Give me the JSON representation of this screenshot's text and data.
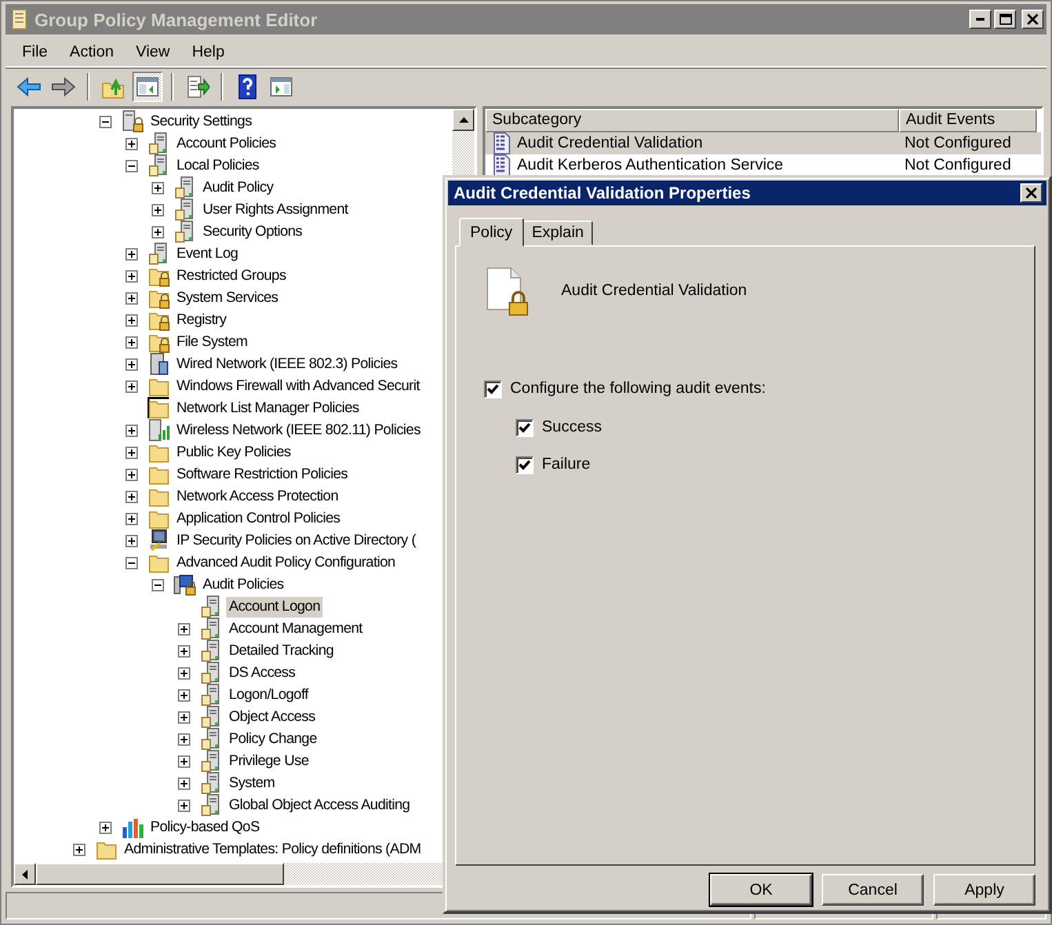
{
  "window": {
    "title": "Group Policy Management Editor"
  },
  "menu": [
    "File",
    "Action",
    "View",
    "Help"
  ],
  "toolbar": [
    {
      "kind": "back",
      "pressed": false
    },
    {
      "kind": "forward",
      "pressed": false
    },
    {
      "kind": "separator"
    },
    {
      "kind": "up",
      "pressed": false
    },
    {
      "kind": "tree-toggle",
      "pressed": true
    },
    {
      "kind": "separator"
    },
    {
      "kind": "export",
      "pressed": false
    },
    {
      "kind": "separator"
    },
    {
      "kind": "help",
      "pressed": false
    },
    {
      "kind": "action-pane",
      "pressed": false
    }
  ],
  "tree": {
    "items": [
      {
        "label": "Security Settings",
        "kind": "security",
        "expandable": true,
        "expanded": true,
        "selected": false,
        "children": [
          {
            "label": "Account Policies",
            "kind": "server",
            "expandable": true,
            "expanded": false,
            "selected": false
          },
          {
            "label": "Local Policies",
            "kind": "server",
            "expandable": true,
            "expanded": true,
            "selected": false,
            "children": [
              {
                "label": "Audit Policy",
                "kind": "server",
                "expandable": true,
                "expanded": false,
                "selected": false
              },
              {
                "label": "User Rights Assignment",
                "kind": "server",
                "expandable": true,
                "expanded": false,
                "selected": false
              },
              {
                "label": "Security Options",
                "kind": "server",
                "expandable": true,
                "expanded": false,
                "selected": false
              }
            ]
          },
          {
            "label": "Event Log",
            "kind": "server",
            "expandable": true,
            "expanded": false,
            "selected": false
          },
          {
            "label": "Restricted Groups",
            "kind": "folder-lock",
            "expandable": true,
            "expanded": false,
            "selected": false
          },
          {
            "label": "System Services",
            "kind": "folder-lock",
            "expandable": true,
            "expanded": false,
            "selected": false
          },
          {
            "label": "Registry",
            "kind": "folder-lock",
            "expandable": true,
            "expanded": false,
            "selected": false
          },
          {
            "label": "File System",
            "kind": "folder-lock",
            "expandable": true,
            "expanded": false,
            "selected": false
          },
          {
            "label": "Wired Network (IEEE 802.3) Policies",
            "kind": "wired",
            "expandable": true,
            "expanded": false,
            "selected": false
          },
          {
            "label": "Windows Firewall with Advanced Securit",
            "kind": "folder",
            "expandable": true,
            "expanded": false,
            "selected": false
          },
          {
            "label": "Network List Manager Policies",
            "kind": "folder-framed",
            "expandable": false,
            "selected": false
          },
          {
            "label": "Wireless Network (IEEE 802.11) Policies",
            "kind": "wireless",
            "expandable": true,
            "expanded": false,
            "selected": false
          },
          {
            "label": "Public Key Policies",
            "kind": "folder",
            "expandable": true,
            "expanded": false,
            "selected": false
          },
          {
            "label": "Software Restriction Policies",
            "kind": "folder",
            "expandable": true,
            "expanded": false,
            "selected": false
          },
          {
            "label": "Network Access Protection",
            "kind": "folder",
            "expandable": true,
            "expanded": false,
            "selected": false
          },
          {
            "label": "Application Control Policies",
            "kind": "folder",
            "expandable": true,
            "expanded": false,
            "selected": false
          },
          {
            "label": "IP Security Policies on Active Directory (",
            "kind": "ipsec",
            "expandable": true,
            "expanded": false,
            "selected": false
          },
          {
            "label": "Advanced Audit Policy Configuration",
            "kind": "folder",
            "expandable": true,
            "expanded": true,
            "selected": false,
            "children": [
              {
                "label": "Audit Policies",
                "kind": "audit",
                "expandable": true,
                "expanded": true,
                "selected": false,
                "children": [
                  {
                    "label": "Account Logon",
                    "kind": "server",
                    "expandable": false,
                    "selected": true
                  },
                  {
                    "label": "Account Management",
                    "kind": "server",
                    "expandable": true,
                    "expanded": false,
                    "selected": false
                  },
                  {
                    "label": "Detailed Tracking",
                    "kind": "server",
                    "expandable": true,
                    "expanded": false,
                    "selected": false
                  },
                  {
                    "label": "DS Access",
                    "kind": "server",
                    "expandable": true,
                    "expanded": false,
                    "selected": false
                  },
                  {
                    "label": "Logon/Logoff",
                    "kind": "server",
                    "expandable": true,
                    "expanded": false,
                    "selected": false
                  },
                  {
                    "label": "Object Access",
                    "kind": "server",
                    "expandable": true,
                    "expanded": false,
                    "selected": false
                  },
                  {
                    "label": "Policy Change",
                    "kind": "server",
                    "expandable": true,
                    "expanded": false,
                    "selected": false
                  },
                  {
                    "label": "Privilege Use",
                    "kind": "server",
                    "expandable": true,
                    "expanded": false,
                    "selected": false
                  },
                  {
                    "label": "System",
                    "kind": "server",
                    "expandable": true,
                    "expanded": false,
                    "selected": false
                  },
                  {
                    "label": "Global Object Access Auditing",
                    "kind": "server",
                    "expandable": true,
                    "expanded": false,
                    "selected": false
                  }
                ]
              }
            ]
          }
        ]
      },
      {
        "label": "Policy-based QoS",
        "kind": "qos",
        "expandable": true,
        "expanded": false,
        "selected": false
      }
    ],
    "outer_items": [
      {
        "label": "Administrative Templates: Policy definitions (ADM",
        "kind": "folder",
        "expandable": true,
        "expanded": false,
        "selected": false
      }
    ]
  },
  "list": {
    "columns": [
      "Subcategory",
      "Audit Events"
    ],
    "rows": [
      {
        "subcategory": "Audit Credential Validation",
        "audit_events": "Not Configured",
        "selected": true
      },
      {
        "subcategory": "Audit Kerberos Authentication Service",
        "audit_events": "Not Configured",
        "selected": false
      }
    ]
  },
  "dialog": {
    "title": "Audit Credential Validation Properties",
    "tabs": [
      {
        "label": "Policy",
        "selected": true
      },
      {
        "label": "Explain",
        "selected": false
      }
    ],
    "policy_name": "Audit Credential Validation",
    "configure": {
      "label": "Configure the following audit events:",
      "checked": true
    },
    "events": [
      {
        "label": "Success",
        "checked": true
      },
      {
        "label": "Failure",
        "checked": true
      }
    ],
    "buttons": [
      {
        "label": "OK",
        "default": true
      },
      {
        "label": "Cancel",
        "default": false
      },
      {
        "label": "Apply",
        "default": false
      }
    ]
  }
}
